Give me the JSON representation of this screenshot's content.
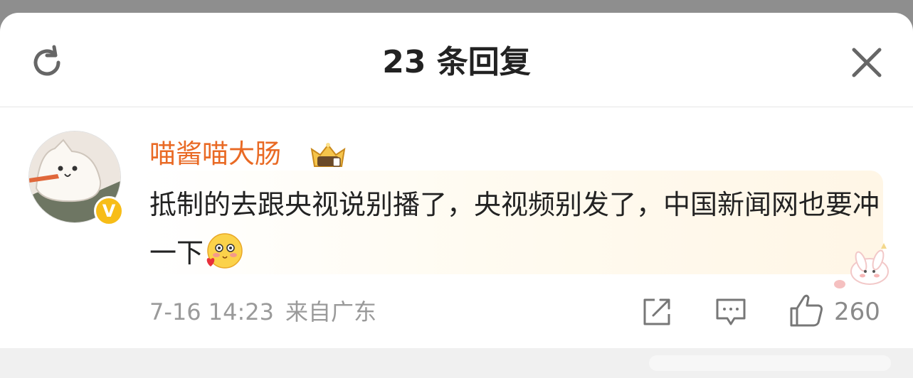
{
  "header": {
    "title": "23 条回复",
    "refresh_icon": "refresh-icon",
    "close_icon": "close-icon"
  },
  "comment": {
    "username": "喵酱喵大肠",
    "username_color": "#e96a25",
    "verified_badge": "V",
    "verified_color": "#f7bd18",
    "text": "抵制的去跟央视说别播了，央视频别发了，中国新闻网也要冲一下",
    "emoji": "blush-hearts-emoji",
    "date": "7-16 14:23",
    "location": "来自广东",
    "likes": "260",
    "accent_bubble": "#fff6e6"
  }
}
